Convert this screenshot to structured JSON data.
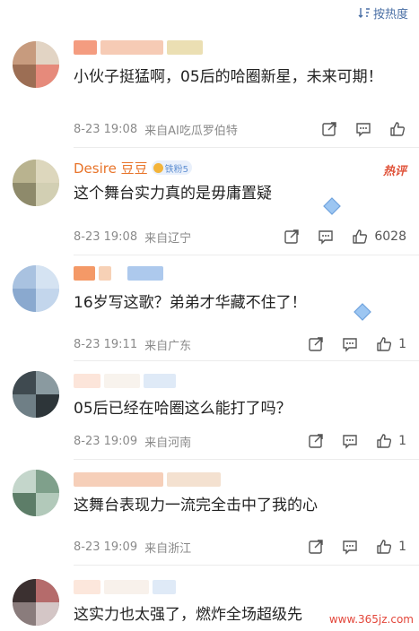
{
  "sort": {
    "label": "按热度"
  },
  "comments": [
    {
      "name": "",
      "verified": true,
      "text": "小伙子挺猛啊，05后的哈圈新星，未来可期！",
      "time": "8-23 19:08",
      "source": "来自AI吃瓜罗伯特",
      "likes": ""
    },
    {
      "name": "Desire 豆豆",
      "badge": "铁粉5",
      "hot": "热评",
      "text": "这个舞台实力真的是毋庸置疑",
      "time": "8-23 19:08",
      "source": "来自辽宁",
      "likes": "6028"
    },
    {
      "name": "",
      "text": "16岁写这歌？弟弟才华藏不住了！",
      "time": "8-23 19:11",
      "source": "来自广东",
      "likes": "1"
    },
    {
      "name": "",
      "text": "05后已经在哈圈这么能打了吗？",
      "time": "8-23 19:09",
      "source": "来自河南",
      "likes": "1"
    },
    {
      "name": "",
      "text": "这舞台表现力一流完全击中了我的心",
      "time": "8-23 19:09",
      "source": "来自浙江",
      "likes": "1"
    },
    {
      "name": "",
      "text": "这实力也太强了，燃炸全场超级先",
      "time": "",
      "source": "",
      "likes": ""
    }
  ],
  "watermark": "www.365jz.com"
}
